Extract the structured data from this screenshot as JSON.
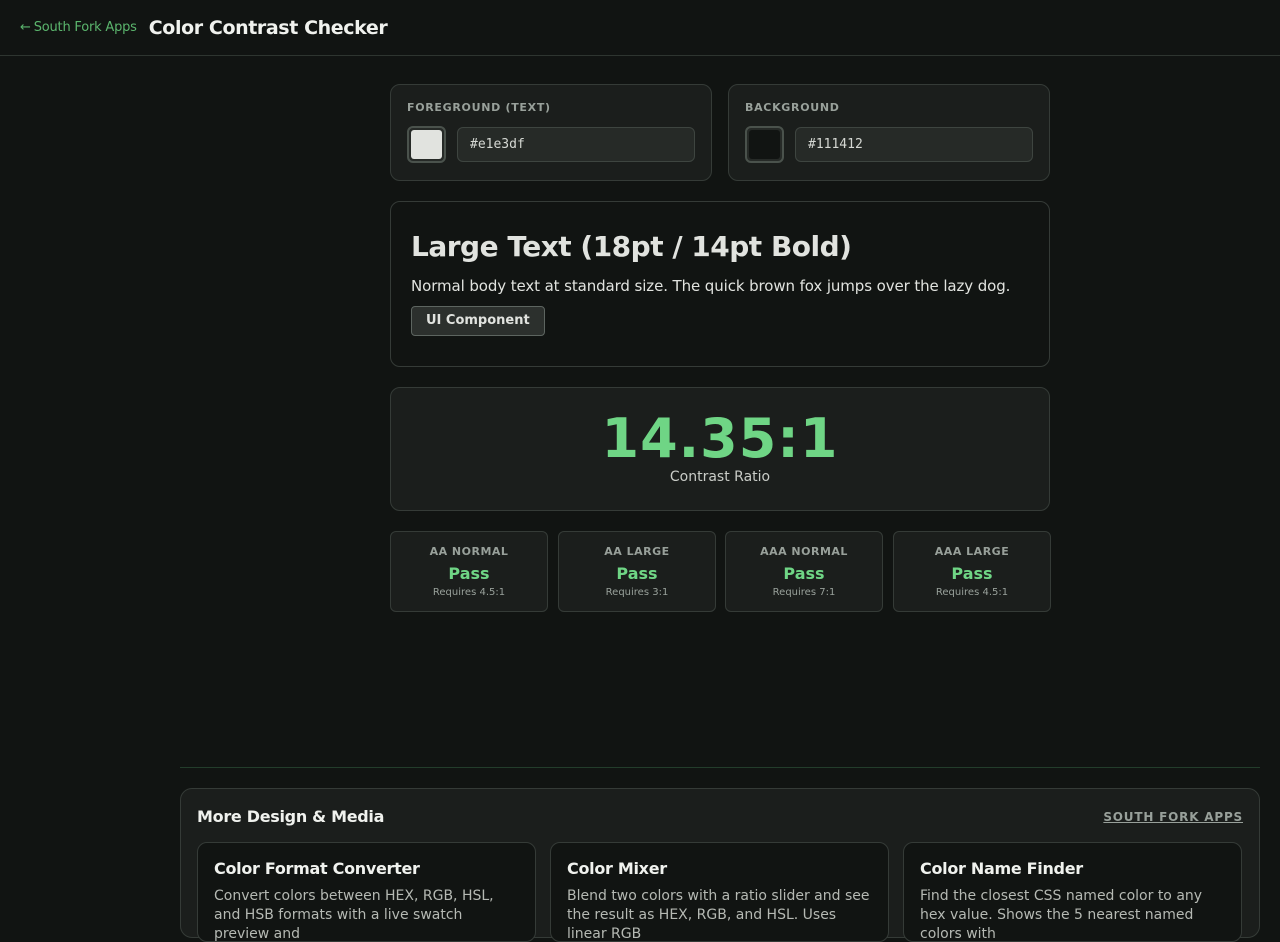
{
  "header": {
    "back_arrow": "←",
    "back_label": "South Fork Apps",
    "title": "Color Contrast Checker"
  },
  "foreground": {
    "label": "FOREGROUND (TEXT)",
    "value": "#e1e3df",
    "color": "#e1e3df"
  },
  "background": {
    "label": "BACKGROUND",
    "value": "#111412",
    "color": "#111412"
  },
  "preview": {
    "large_text": "Large Text (18pt / 14pt Bold)",
    "body_text": "Normal body text at standard size. The quick brown fox jumps over the lazy dog.",
    "ui_component": "UI Component"
  },
  "ratio": {
    "value": "14.35:1",
    "label": "Contrast Ratio"
  },
  "results": [
    {
      "label": "AA NORMAL",
      "status": "Pass",
      "requirement": "Requires 4.5:1"
    },
    {
      "label": "AA LARGE",
      "status": "Pass",
      "requirement": "Requires 3:1"
    },
    {
      "label": "AAA NORMAL",
      "status": "Pass",
      "requirement": "Requires 7:1"
    },
    {
      "label": "AAA LARGE",
      "status": "Pass",
      "requirement": "Requires 4.5:1"
    }
  ],
  "more": {
    "title": "More Design & Media",
    "brand": "SOUTH FORK APPS",
    "apps": [
      {
        "title": "Color Format Converter",
        "description": "Convert colors between HEX, RGB, HSL, and HSB formats with a live swatch preview and"
      },
      {
        "title": "Color Mixer",
        "description": "Blend two colors with a ratio slider and see the result as HEX, RGB, and HSL. Uses linear RGB"
      },
      {
        "title": "Color Name Finder",
        "description": "Find the closest CSS named color to any hex value. Shows the 5 nearest named colors with"
      }
    ]
  },
  "colors": {
    "accent": "#5bb56d",
    "pass": "#6fd585",
    "page_background": "#111412",
    "card_background": "#1b1e1c"
  }
}
